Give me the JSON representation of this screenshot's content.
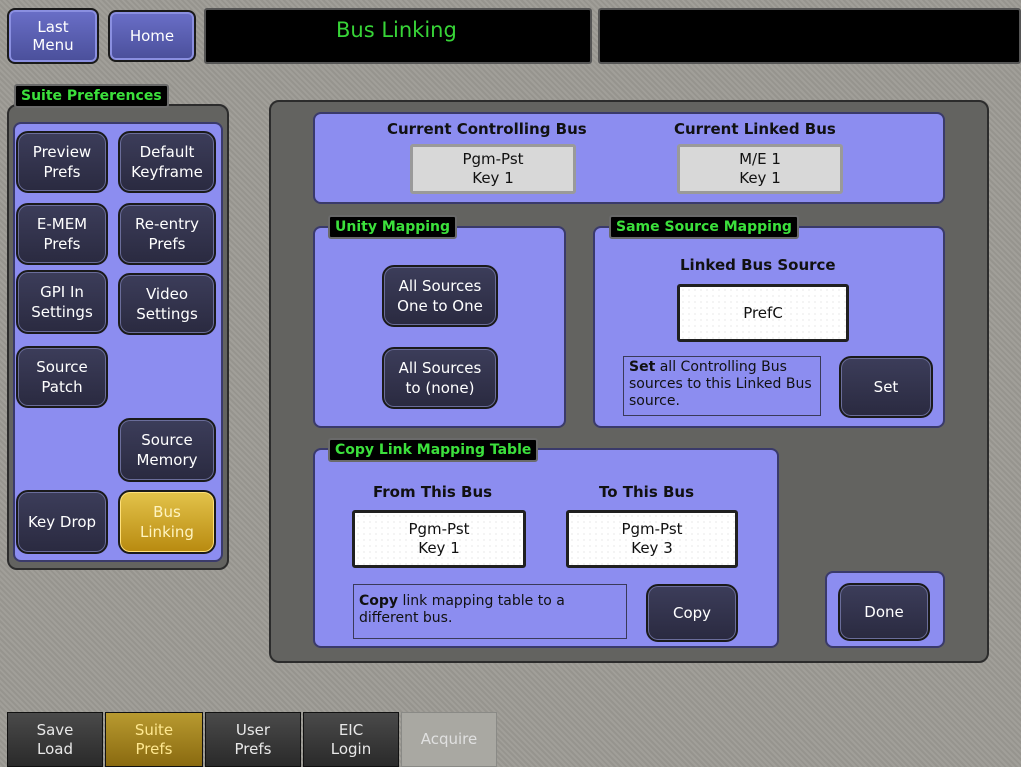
{
  "header": {
    "last_menu": "Last\nMenu",
    "home": "Home",
    "title": "Bus Linking"
  },
  "sidebar": {
    "group_title": "Suite Preferences",
    "buttons": [
      {
        "label": "Preview\nPrefs"
      },
      {
        "label": "Default\nKeyframe"
      },
      {
        "label": "E-MEM\nPrefs"
      },
      {
        "label": "Re-entry\nPrefs"
      },
      {
        "label": "GPI In\nSettings"
      },
      {
        "label": "Video\nSettings"
      },
      {
        "label": "Source\nPatch"
      },
      {
        "label": "Source\nMemory"
      },
      {
        "label": "Key Drop"
      },
      {
        "label": "Bus\nLinking"
      }
    ]
  },
  "current_bus": {
    "controlling_label": "Current Controlling Bus",
    "controlling_value": "Pgm-Pst\nKey 1",
    "linked_label": "Current Linked Bus",
    "linked_value": "M/E 1\nKey 1"
  },
  "unity_mapping": {
    "title": "Unity Mapping",
    "one_to_one": "All Sources\nOne to One",
    "to_none": "All Sources\nto (none)"
  },
  "same_source": {
    "title": "Same Source Mapping",
    "linked_source_label": "Linked Bus Source",
    "linked_source_value": "PrefC",
    "note_bold": "Set",
    "note_text": " all Controlling Bus sources to this Linked Bus source.",
    "set_button": "Set"
  },
  "copy_table": {
    "title": "Copy Link Mapping Table",
    "from_label": "From This Bus",
    "from_value": "Pgm-Pst\nKey 1",
    "to_label": "To This Bus",
    "to_value": "Pgm-Pst\nKey 3",
    "note_bold": "Copy",
    "note_text": " link mapping table to a different bus.",
    "copy_button": "Copy"
  },
  "done_button": "Done",
  "bottom_tabs": [
    {
      "label": "Save\nLoad"
    },
    {
      "label": "Suite\nPrefs"
    },
    {
      "label": "User\nPrefs"
    },
    {
      "label": "EIC\nLogin"
    },
    {
      "label": "Acquire"
    }
  ]
}
